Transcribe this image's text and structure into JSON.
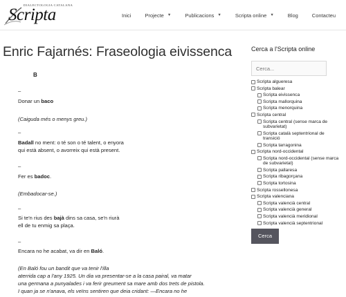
{
  "header": {
    "logo_small": "DIALECTOLOGIA CATALANA",
    "logo_text": "Scripta",
    "nav": [
      {
        "label": "Inici",
        "has_menu": false
      },
      {
        "label": "Projecte",
        "has_menu": true
      },
      {
        "label": "Publicacions",
        "has_menu": true
      },
      {
        "label": "Scripta online",
        "has_menu": true
      },
      {
        "label": "Blog",
        "has_menu": false
      },
      {
        "label": "Contacteu",
        "has_menu": false
      }
    ],
    "chevron_glyph": "▼"
  },
  "page": {
    "title": "Enric Fajarnés: Fraseologia eivissenca",
    "letter": "B",
    "dash": "–",
    "entries": {
      "e1": {
        "pre": "Donar un ",
        "bold": "baco",
        "post": ""
      },
      "e1_note": "(Caiguda més o menys greu.)",
      "e2_line1": {
        "bold": "Badall",
        "post": " no ment: o té son o té talent, o enyora"
      },
      "e2_line2": "qui està absent, o avorreix qui està present.",
      "e3": {
        "pre": "Fer es ",
        "bold": "badoc",
        "post": "."
      },
      "e3_note": "(Embadocar-se.)",
      "e4_line1": {
        "pre": "Si te'n rius des ",
        "bold": "bajà",
        "post": " dins sa casa, se'n riurà"
      },
      "e4_line2": "ell de tu enmig sa plaça.",
      "e5": {
        "pre": "Encara no he acabat, va dir en ",
        "bold": "Baló",
        "post": "."
      },
      "e5_note": [
        "(En Baló fou un bandit que va tenir l'illa",
        "aterrida cap a l'any 1925. Un dia va presentar-se a la casa pairal, va matar",
        "una germana a punyalades i va ferir greument sa mare amb dos trets de pistola.",
        "I quan ja se n'anava, els veïns sentiren que deia cridant: —Encara no he"
      ]
    }
  },
  "sidebar": {
    "title": "Cerca a l'Scripta online",
    "search_placeholder": "Cerca...",
    "button": "Cerca",
    "items": [
      {
        "label": "Scripta algueresa",
        "child": false
      },
      {
        "label": "Scripta balear",
        "child": false
      },
      {
        "label": "Scripta eivissenca",
        "child": true
      },
      {
        "label": "Scripta mallorquina",
        "child": true
      },
      {
        "label": "Scripta menorquina",
        "child": true
      },
      {
        "label": "Scripta central",
        "child": false
      },
      {
        "label": "Scripta central (sense marca de subvarietat)",
        "child": true
      },
      {
        "label": "Scripta català septentrional de transició",
        "child": true
      },
      {
        "label": "Scripta tarragonina",
        "child": true
      },
      {
        "label": "Scripta nord-occidental",
        "child": false
      },
      {
        "label": "Scripta nord-occidental (sense marca de subvarietat)",
        "child": true
      },
      {
        "label": "Scripta pallaresa",
        "child": true
      },
      {
        "label": "Scripta ribagorçana",
        "child": true
      },
      {
        "label": "Scripta tortosina",
        "child": true
      },
      {
        "label": "Scripta rossellonesa",
        "child": false
      },
      {
        "label": "Scripta valenciana",
        "child": false
      },
      {
        "label": "Scripta valencià central",
        "child": true
      },
      {
        "label": "Scripta valencià general",
        "child": true
      },
      {
        "label": "Scripta valencià meridional",
        "child": true
      },
      {
        "label": "Scripta valencià septentrional",
        "child": true
      }
    ]
  }
}
